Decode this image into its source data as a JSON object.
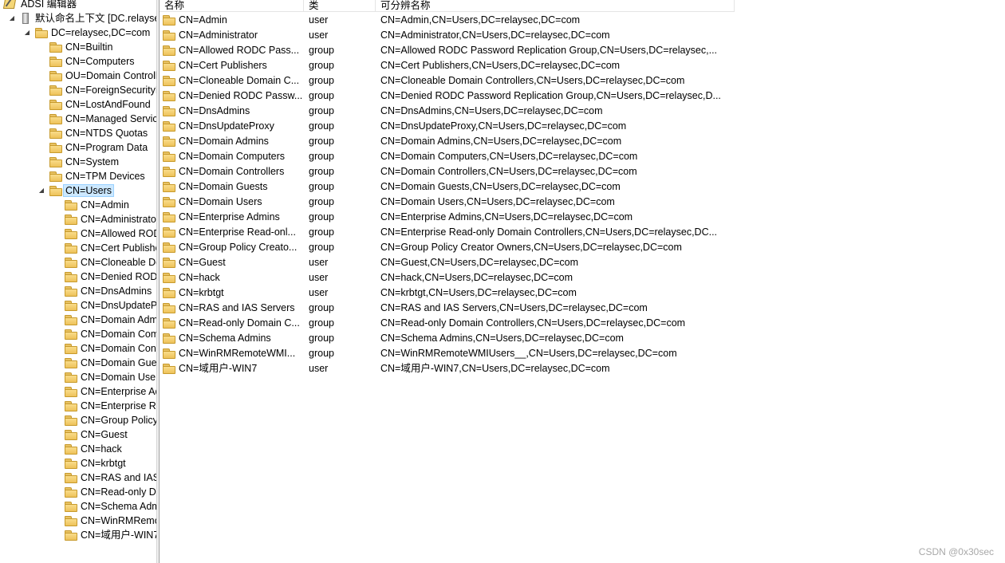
{
  "window_title": "ADSI 编辑器",
  "tree": {
    "root_label": "默认命名上下文 [DC.relaysec.com]",
    "domain_label": "DC=relaysec,DC=com",
    "containers": [
      "CN=Builtin",
      "CN=Computers",
      "OU=Domain Controllers",
      "CN=ForeignSecurityPrincipals",
      "CN=LostAndFound",
      "CN=Managed Service Accounts",
      "CN=NTDS Quotas",
      "CN=Program Data",
      "CN=System",
      "CN=TPM Devices"
    ],
    "selected_label": "CN=Users",
    "users_children": [
      "CN=Admin",
      "CN=Administrator",
      "CN=Allowed RODC Password Replication Group",
      "CN=Cert Publishers",
      "CN=Cloneable Domain Controllers",
      "CN=Denied RODC Password Replication Group",
      "CN=DnsAdmins",
      "CN=DnsUpdateProxy",
      "CN=Domain Admins",
      "CN=Domain Computers",
      "CN=Domain Controllers",
      "CN=Domain Guests",
      "CN=Domain Users",
      "CN=Enterprise Admins",
      "CN=Enterprise Read-only Domain Controllers",
      "CN=Group Policy Creator Owners",
      "CN=Guest",
      "CN=hack",
      "CN=krbtgt",
      "CN=RAS and IAS Servers",
      "CN=Read-only Domain Controllers",
      "CN=Schema Admins",
      "CN=WinRMRemoteWMIUsers__",
      "CN=域用户-WIN7"
    ]
  },
  "list": {
    "columns": [
      "名称",
      "类",
      "可分辨名称"
    ],
    "rows": [
      {
        "name": "CN=Admin",
        "class": "user",
        "dn": "CN=Admin,CN=Users,DC=relaysec,DC=com"
      },
      {
        "name": "CN=Administrator",
        "class": "user",
        "dn": "CN=Administrator,CN=Users,DC=relaysec,DC=com"
      },
      {
        "name": "CN=Allowed RODC Pass...",
        "class": "group",
        "dn": "CN=Allowed RODC Password Replication Group,CN=Users,DC=relaysec,..."
      },
      {
        "name": "CN=Cert Publishers",
        "class": "group",
        "dn": "CN=Cert Publishers,CN=Users,DC=relaysec,DC=com"
      },
      {
        "name": "CN=Cloneable Domain C...",
        "class": "group",
        "dn": "CN=Cloneable Domain Controllers,CN=Users,DC=relaysec,DC=com"
      },
      {
        "name": "CN=Denied RODC Passw...",
        "class": "group",
        "dn": "CN=Denied RODC Password Replication Group,CN=Users,DC=relaysec,D..."
      },
      {
        "name": "CN=DnsAdmins",
        "class": "group",
        "dn": "CN=DnsAdmins,CN=Users,DC=relaysec,DC=com"
      },
      {
        "name": "CN=DnsUpdateProxy",
        "class": "group",
        "dn": "CN=DnsUpdateProxy,CN=Users,DC=relaysec,DC=com"
      },
      {
        "name": "CN=Domain Admins",
        "class": "group",
        "dn": "CN=Domain Admins,CN=Users,DC=relaysec,DC=com"
      },
      {
        "name": "CN=Domain Computers",
        "class": "group",
        "dn": "CN=Domain Computers,CN=Users,DC=relaysec,DC=com"
      },
      {
        "name": "CN=Domain Controllers",
        "class": "group",
        "dn": "CN=Domain Controllers,CN=Users,DC=relaysec,DC=com"
      },
      {
        "name": "CN=Domain Guests",
        "class": "group",
        "dn": "CN=Domain Guests,CN=Users,DC=relaysec,DC=com"
      },
      {
        "name": "CN=Domain Users",
        "class": "group",
        "dn": "CN=Domain Users,CN=Users,DC=relaysec,DC=com"
      },
      {
        "name": "CN=Enterprise Admins",
        "class": "group",
        "dn": "CN=Enterprise Admins,CN=Users,DC=relaysec,DC=com"
      },
      {
        "name": "CN=Enterprise Read-onl...",
        "class": "group",
        "dn": "CN=Enterprise Read-only Domain Controllers,CN=Users,DC=relaysec,DC..."
      },
      {
        "name": "CN=Group Policy Creato...",
        "class": "group",
        "dn": "CN=Group Policy Creator Owners,CN=Users,DC=relaysec,DC=com"
      },
      {
        "name": "CN=Guest",
        "class": "user",
        "dn": "CN=Guest,CN=Users,DC=relaysec,DC=com"
      },
      {
        "name": "CN=hack",
        "class": "user",
        "dn": "CN=hack,CN=Users,DC=relaysec,DC=com"
      },
      {
        "name": "CN=krbtgt",
        "class": "user",
        "dn": "CN=krbtgt,CN=Users,DC=relaysec,DC=com"
      },
      {
        "name": "CN=RAS and IAS Servers",
        "class": "group",
        "dn": "CN=RAS and IAS Servers,CN=Users,DC=relaysec,DC=com"
      },
      {
        "name": "CN=Read-only Domain C...",
        "class": "group",
        "dn": "CN=Read-only Domain Controllers,CN=Users,DC=relaysec,DC=com"
      },
      {
        "name": "CN=Schema Admins",
        "class": "group",
        "dn": "CN=Schema Admins,CN=Users,DC=relaysec,DC=com"
      },
      {
        "name": "CN=WinRMRemoteWMI...",
        "class": "group",
        "dn": "CN=WinRMRemoteWMIUsers__,CN=Users,DC=relaysec,DC=com"
      },
      {
        "name": "CN=域用户-WIN7",
        "class": "user",
        "dn": "CN=域用户-WIN7,CN=Users,DC=relaysec,DC=com"
      }
    ]
  },
  "watermark": "CSDN @0x30sec",
  "icons": {
    "expanded": "triangle-down-icon",
    "container": "folder-icon",
    "server": "server-icon",
    "app": "adsi-edit-icon"
  },
  "colors": {
    "selection_bg": "#cce8ff",
    "selection_border": "#99d1ff",
    "folder": "#f9dc8a"
  }
}
